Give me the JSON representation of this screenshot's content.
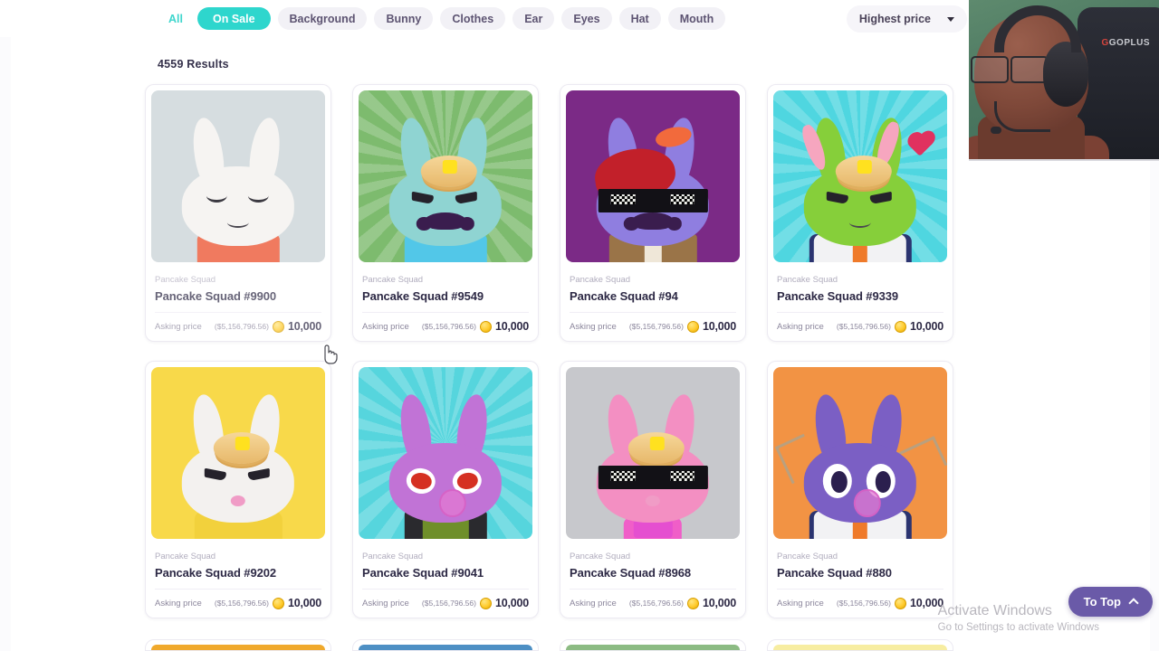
{
  "filters": {
    "chips": [
      {
        "label": "All",
        "state": "link"
      },
      {
        "label": "On Sale",
        "state": "active"
      },
      {
        "label": "Background",
        "state": "idle"
      },
      {
        "label": "Bunny",
        "state": "idle"
      },
      {
        "label": "Clothes",
        "state": "idle"
      },
      {
        "label": "Ear",
        "state": "idle"
      },
      {
        "label": "Eyes",
        "state": "idle"
      },
      {
        "label": "Hat",
        "state": "idle"
      },
      {
        "label": "Mouth",
        "state": "idle"
      }
    ],
    "active_color": "#2ed6cd"
  },
  "sort": {
    "selected": "Highest price",
    "icon": "chevron-down-icon"
  },
  "results": {
    "count_label": "4559 Results"
  },
  "labels": {
    "collection": "Pancake Squad",
    "asking_price": "Asking price",
    "coin_icon": "coin-icon"
  },
  "cards": [
    {
      "collection": "Pancake Squad",
      "title": "Pancake Squad #9900",
      "price_label": "Asking price",
      "usd": "($5,156,796.56)",
      "amount": "10,000",
      "bg": "#d6dde0",
      "bg_style": "flat",
      "bunny": {
        "fur": "#f6f4f2",
        "eyes": "closed",
        "mouth": "flat",
        "hat": "none",
        "outfit": "tee",
        "extras": []
      }
    },
    {
      "collection": "Pancake Squad",
      "title": "Pancake Squad #9549",
      "price_label": "Asking price",
      "usd": "($5,156,796.56)",
      "amount": "10,000",
      "bg": "#7dbb6e",
      "bg_style": "burst",
      "bunny": {
        "fur": "#8fd4d2",
        "eyes": "slant",
        "mouth": "mustache",
        "hat": "pancake",
        "outfit": "blue-shirt",
        "extras": []
      }
    },
    {
      "collection": "Pancake Squad",
      "title": "Pancake Squad #94",
      "price_label": "Asking price",
      "usd": "($5,156,796.56)",
      "amount": "10,000",
      "bg": "#7b2a86",
      "bg_style": "flat",
      "bunny": {
        "fur": "#8f7ee0",
        "eyes": "shades",
        "mouth": "mustache",
        "hat": "beret",
        "outfit": "tweed",
        "extras": [
          "orange-bow"
        ]
      }
    },
    {
      "collection": "Pancake Squad",
      "title": "Pancake Squad #9339",
      "price_label": "Asking price",
      "usd": "($5,156,796.56)",
      "amount": "10,000",
      "bg": "#4fd6e0",
      "bg_style": "burst",
      "bunny": {
        "fur": "#86cf3a",
        "eyes": "slant",
        "mouth": "flat",
        "hat": "pancake",
        "outfit": "sailor",
        "extras": [
          "worms",
          "heart"
        ]
      }
    },
    {
      "collection": "Pancake Squad",
      "title": "Pancake Squad #9202",
      "price_label": "Asking price",
      "usd": "($5,156,796.56)",
      "amount": "10,000",
      "bg": "#f8d94a",
      "bg_style": "flat",
      "bunny": {
        "fur": "#f3f1ef",
        "eyes": "slant",
        "mouth": "pink",
        "hat": "pancake-stack",
        "outfit": "hoodie",
        "extras": []
      }
    },
    {
      "collection": "Pancake Squad",
      "title": "Pancake Squad #9041",
      "price_label": "Asking price",
      "usd": "($5,156,796.56)",
      "amount": "10,000",
      "bg": "#56d5dd",
      "bg_style": "burst",
      "bunny": {
        "fur": "#c173d6",
        "eyes": "angry",
        "mouth": "bubble",
        "hat": "none",
        "outfit": "apron",
        "extras": []
      }
    },
    {
      "collection": "Pancake Squad",
      "title": "Pancake Squad #8968",
      "price_label": "Asking price",
      "usd": "($5,156,796.56)",
      "amount": "10,000",
      "bg": "#c7c8cc",
      "bg_style": "flat",
      "bunny": {
        "fur": "#f38fc2",
        "eyes": "shades",
        "mouth": "pink",
        "hat": "pancake",
        "outfit": "bowtie",
        "extras": []
      }
    },
    {
      "collection": "Pancake Squad",
      "title": "Pancake Squad #880",
      "price_label": "Asking price",
      "usd": "($5,156,796.56)",
      "amount": "10,000",
      "bg": "#f29344",
      "bg_style": "flat",
      "bunny": {
        "fur": "#7b5fc4",
        "eyes": "big",
        "mouth": "bubble",
        "hat": "none",
        "outfit": "sailor",
        "extras": [
          "antlers"
        ]
      }
    }
  ],
  "partial_row": [
    {
      "bg": "#f0a92c"
    },
    {
      "bg": "#4d8fc4"
    },
    {
      "bg": "#8cbb83"
    },
    {
      "bg": "#f7eda1"
    }
  ],
  "to_top": {
    "label": "To Top",
    "icon": "chevron-up-icon",
    "color": "#6a5aa8"
  },
  "watermark": {
    "line1": "Activate Windows",
    "line2": "Go to Settings to activate Windows"
  },
  "webcam": {
    "chair_brand": "GOPLUS"
  }
}
